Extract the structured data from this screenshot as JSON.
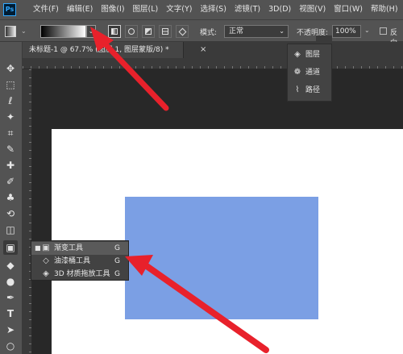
{
  "app": {
    "logo_text": "Ps"
  },
  "menu": [
    "文件(F)",
    "编辑(E)",
    "图像(I)",
    "图层(L)",
    "文字(Y)",
    "选择(S)",
    "滤镜(T)",
    "3D(D)",
    "视图(V)",
    "窗口(W)",
    "帮助(H)"
  ],
  "options_bar": {
    "mode_label": "模式:",
    "mode_value": "正常",
    "opacity_label": "不透明度:",
    "opacity_value": "100%",
    "reverse_label": "反向"
  },
  "document_tab": {
    "title": "未标题-1 @ 67.7% (图层 1, 图层蒙版/8) *",
    "close": "×"
  },
  "panels": [
    {
      "label": "图层",
      "icon": "layers-icon",
      "glyph": "◈"
    },
    {
      "label": "通道",
      "icon": "channels-icon",
      "glyph": "❁"
    },
    {
      "label": "路径",
      "icon": "paths-icon",
      "glyph": "⌇"
    }
  ],
  "tool_flyout": [
    {
      "label": "渐变工具",
      "shortcut": "G",
      "icon": "gradient-tool-icon",
      "glyph": "▣",
      "selected": true
    },
    {
      "label": "油漆桶工具",
      "shortcut": "G",
      "icon": "paint-bucket-icon",
      "glyph": "◇",
      "selected": false
    },
    {
      "label": "3D 材质拖放工具",
      "shortcut": "G",
      "icon": "3d-material-drop-icon",
      "glyph": "◈",
      "selected": false
    }
  ],
  "colors": {
    "canvas_shape": "#7b9fe4",
    "arrow": "#e8212b"
  }
}
